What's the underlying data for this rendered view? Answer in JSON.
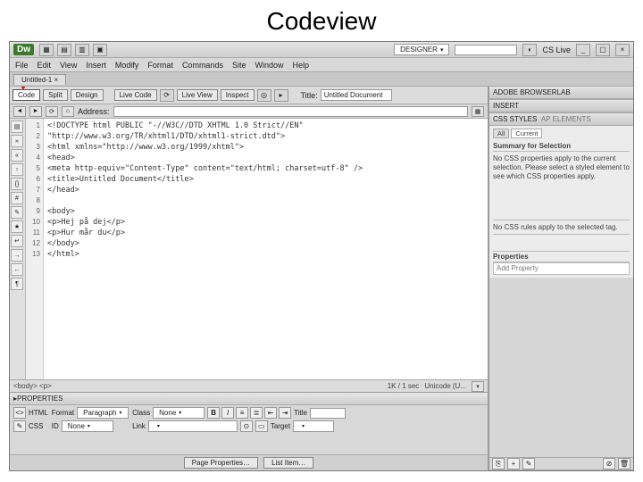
{
  "slide_title": "Codeview",
  "topbar": {
    "logo": "Dw",
    "layout_dropdown": "DESIGNER",
    "search_placeholder": "",
    "cslive": "CS Live",
    "window_icons": [
      "_",
      "▢",
      "×"
    ]
  },
  "menu": [
    "File",
    "Edit",
    "View",
    "Insert",
    "Modify",
    "Format",
    "Commands",
    "Site",
    "Window",
    "Help"
  ],
  "doc_tab": "Untitled-1",
  "view": {
    "code": "Code",
    "split": "Split",
    "design": "Design",
    "livecode": "Live Code",
    "liveview": "Live View",
    "inspect": "Inspect",
    "title_label": "Title:",
    "title_value": "Untitled Document"
  },
  "address": {
    "label": "Address:"
  },
  "code_lines": [
    "<!DOCTYPE html PUBLIC \"-//W3C//DTD XHTML 1.0 Strict//EN\"",
    "\"http://www.w3.org/TR/xhtml1/DTD/xhtml1-strict.dtd\">",
    "<html xmlns=\"http://www.w3.org/1999/xhtml\">",
    "<head>",
    "<meta http-equiv=\"Content-Type\" content=\"text/html; charset=utf-8\" />",
    "<title>Untitled Document</title>",
    "</head>",
    "",
    "<body>",
    "<p>Hej på dej</p>",
    "<p>Hur mår du</p>",
    "</body>",
    "</html>",
    ""
  ],
  "line_numbers": [
    "1",
    "2",
    "3",
    "4",
    "5",
    "6",
    "7",
    "8",
    "9",
    "10",
    "11",
    "12",
    "13"
  ],
  "footer": {
    "path": "<body> <p>",
    "size": "1K / 1 sec",
    "enc": "Unicode (U..."
  },
  "props": {
    "header": "PROPERTIES",
    "mode_html": "HTML",
    "mode_css": "CSS",
    "format_label": "Format",
    "format_value": "Paragraph",
    "id_label": "ID",
    "id_value": "None",
    "class_label": "Class",
    "class_value": "None",
    "link_label": "Link",
    "title_label": "Title",
    "target_label": "Target",
    "page_props": "Page Properties…",
    "list_item": "List Item…"
  },
  "right": {
    "adobe_panel": "ADOBE BROWSERLAB",
    "insert_panel": "INSERT",
    "css_panel": "CSS STYLES",
    "ap_tab": "AP ELEMENTS",
    "all": "All",
    "current": "Current",
    "summary_hdr": "Summary for Selection",
    "summary_text": "No CSS properties apply to the current selection. Please select a styled element to see which CSS properties apply.",
    "rules_text": "No CSS rules apply to the selected tag.",
    "properties_hdr": "Properties",
    "add_property": "Add Property"
  }
}
